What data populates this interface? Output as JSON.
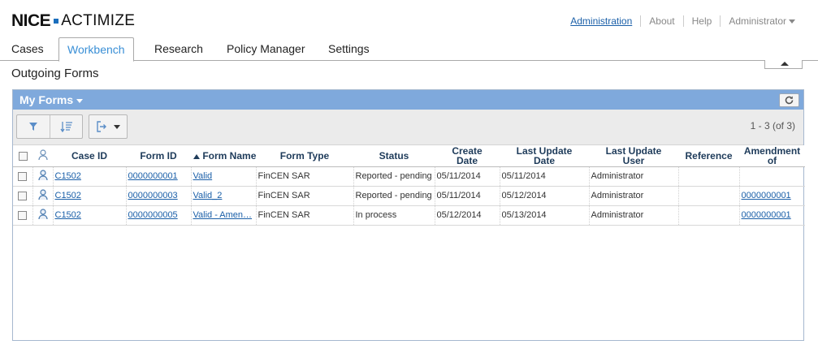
{
  "brand": {
    "nice": "NICE",
    "actimize": "ACTIMIZE"
  },
  "top_links": {
    "administration": "Administration",
    "about": "About",
    "help": "Help",
    "user": "Administrator"
  },
  "tabs": [
    "Cases",
    "Workbench",
    "Research",
    "Policy Manager",
    "Settings"
  ],
  "active_tab": "Workbench",
  "page_title": "Outgoing Forms",
  "panel": {
    "title": "My Forms",
    "pager": "1 - 3 (of 3)"
  },
  "columns": [
    "Case ID",
    "Form ID",
    "Form Name",
    "Form Type",
    "Status",
    "Create Date",
    "Last Update Date",
    "Last Update User",
    "Reference",
    "Amendment of"
  ],
  "column_lines": {
    "create": [
      "Create",
      "Date"
    ],
    "last_update": [
      "Last Update",
      "Date"
    ],
    "last_user": [
      "Last Update",
      "User"
    ],
    "amendment": [
      "Amendment",
      "of"
    ]
  },
  "sorted_column": "Form ID",
  "rows": [
    {
      "case_id": "C1502",
      "form_id": "0000000001",
      "form_name": "Valid",
      "form_type": "FinCEN SAR",
      "status": "Reported - pending",
      "create_date": "05/11/2014",
      "last_update_date": "05/11/2014",
      "last_update_user": "Administrator",
      "reference": "",
      "amendment_of": ""
    },
    {
      "case_id": "C1502",
      "form_id": "0000000003",
      "form_name": "Valid_2",
      "form_type": "FinCEN SAR",
      "status": "Reported - pending",
      "create_date": "05/11/2014",
      "last_update_date": "05/12/2014",
      "last_update_user": "Administrator",
      "reference": "",
      "amendment_of": "0000000001"
    },
    {
      "case_id": "C1502",
      "form_id": "0000000005",
      "form_name": "Valid - Amen…",
      "form_type": "FinCEN SAR",
      "status": "In process",
      "create_date": "05/12/2014",
      "last_update_date": "05/13/2014",
      "last_update_user": "Administrator",
      "reference": "",
      "amendment_of": "0000000001"
    }
  ],
  "icons": {
    "filter": "filter-icon",
    "sort": "sort-icon",
    "export": "export-icon",
    "refresh": "refresh-icon",
    "user": "user-icon"
  },
  "colors": {
    "accent": "#3a8fd6",
    "panel_header": "#7fa9dc",
    "link": "#1a5fa8"
  }
}
